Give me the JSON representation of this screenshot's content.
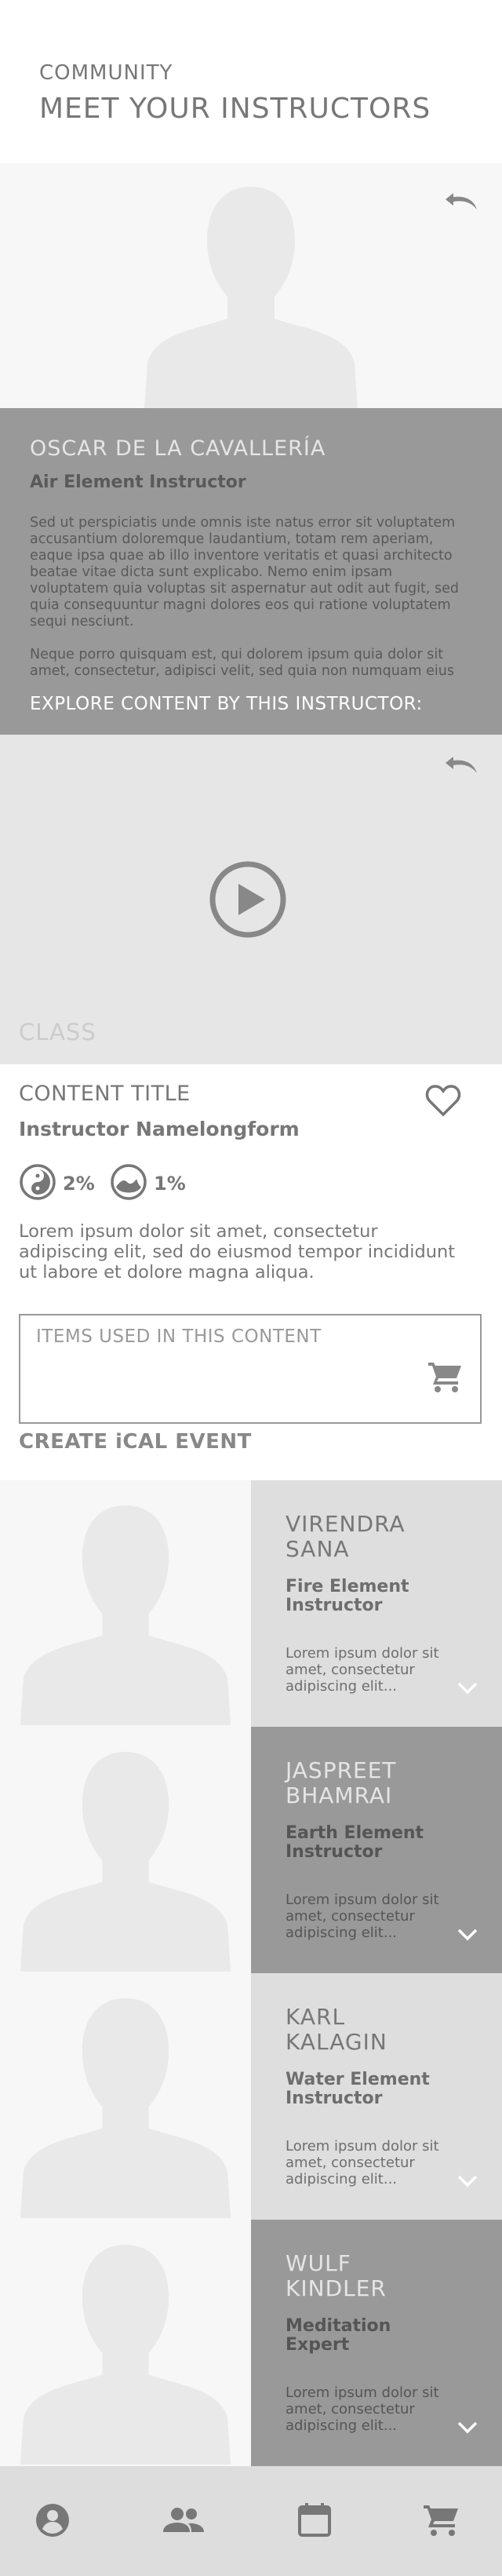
{
  "header": {
    "eyebrow": "COMMUNITY",
    "title": "MEET YOUR INSTRUCTORS"
  },
  "featured": {
    "name": "OSCAR DE LA CAVALLERÍA",
    "role": "Air Element Instructor",
    "bio_paragraphs": [
      "Sed ut perspiciatis unde omnis iste natus error sit voluptatem accusantium doloremque laudantium, totam rem aperiam, eaque ipsa quae ab illo inventore veritatis et quasi architecto beatae vitae dicta sunt explicabo. Nemo enim ipsam voluptatem quia voluptas sit aspernatur aut odit aut fugit, sed quia consequuntur magni dolores eos qui ratione voluptatem sequi nesciunt.",
      "Neque porro quisquam est, qui dolorem ipsum quia dolor sit amet, consectetur, adipisci velit, sed quia non numquam eius modi tempora incidunt ut labore et dolore magnam aliquam quaerat voluptatem."
    ],
    "cta": "EXPLORE CONTENT BY THIS INSTRUCTOR:",
    "undo_icon": "undo-icon"
  },
  "video": {
    "class_label": "CLASS",
    "play_icon": "play-icon"
  },
  "content": {
    "title": "CONTENT TITLE",
    "instructor": "Instructor Namelongform",
    "stats": [
      {
        "icon": "yin-yang-icon",
        "value": "2%"
      },
      {
        "icon": "wave-icon",
        "value": "1%"
      }
    ],
    "description": "Lorem ipsum dolor sit amet, consectetur adipiscing elit, sed do eiusmod tempor incididunt ut labore et dolore magna aliqua.",
    "items_label": "ITEMS USED IN THIS CONTENT",
    "ical": "CREATE iCAL EVENT"
  },
  "instructors": [
    {
      "name": "VIRENDRA SANA",
      "role": "Fire Element Instructor",
      "desc": "Lorem ipsum dolor sit amet, consectetur adipiscing elit..."
    },
    {
      "name": "JASPREET BHAMRAI",
      "role": "Earth Element Instructor",
      "desc": "Lorem ipsum dolor sit amet, consectetur adipiscing elit..."
    },
    {
      "name": "KARL KALAGIN",
      "role": "Water Element Instructor",
      "desc": "Lorem ipsum dolor sit amet, consectetur adipiscing elit..."
    },
    {
      "name": "WULF KINDLER",
      "role": "Meditation Expert",
      "desc": "Lorem ipsum dolor sit amet, consectetur adipiscing elit..."
    }
  ],
  "tabbar": {
    "tabs": [
      "account-icon",
      "community-icon",
      "calendar-icon",
      "cart-icon"
    ]
  },
  "colors": {
    "panel_dark": "#999999",
    "panel_light": "#dedede",
    "photo_bg": "#f7f7f7",
    "video_bg": "#e6e6e6",
    "text": "#777777"
  }
}
